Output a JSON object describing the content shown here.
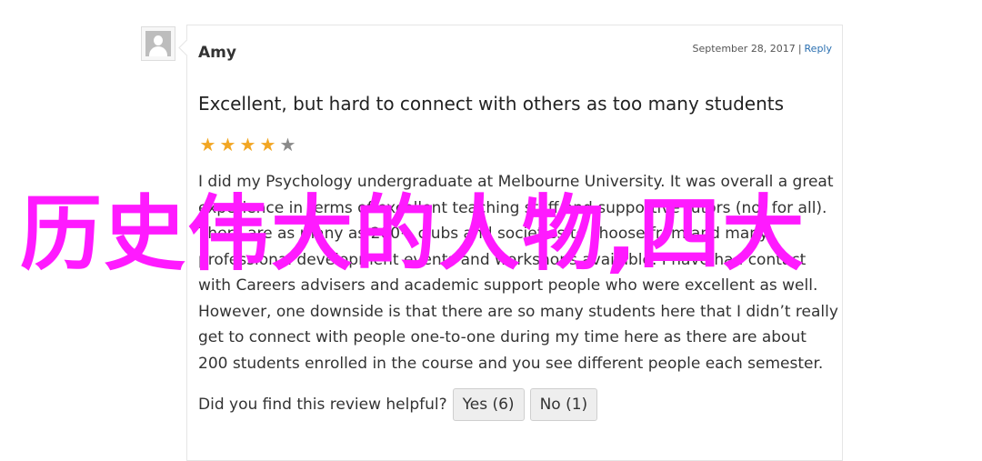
{
  "review": {
    "author": "Amy",
    "date": "September 28, 2017",
    "separator": "|",
    "reply_label": "Reply",
    "title": "Excellent, but hard to connect with others as too many students",
    "rating": 4,
    "rating_max": 5,
    "star_glyph": "★",
    "body": "I did my Psychology undergraduate at Melbourne University. It was overall a great experience in terms of excellent teaching staff and supportive tutors (not for all). There are as many as 200+ clubs and societies to choose from and many professional development events and workshops available. I have had contact with Careers advisers and academic support people who were excellent as well. However, one downside is that there are so many students here that I didn’t really get to connect with people one-to-one during my time here as there are about 200 students enrolled in the course and you see different people each semester.",
    "helpful_question": "Did you find this review helpful?",
    "yes_label": "Yes (6)",
    "no_label": "No (1)"
  },
  "watermark": "历史伟大的人物,四大",
  "colors": {
    "star_on": "#f2a623",
    "star_off": "#8a8a8a",
    "link": "#2a6fb0",
    "watermark": "#ff1aff"
  }
}
